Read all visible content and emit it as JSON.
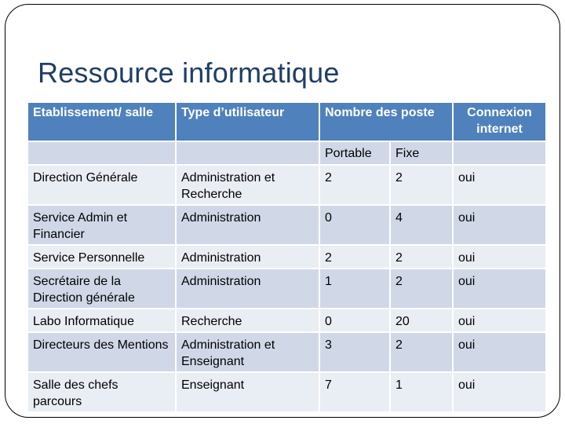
{
  "slide": {
    "title": "Ressource informatique"
  },
  "table": {
    "headers": {
      "establishment": "Etablissement/ salle",
      "user_type": "Type d’utilisateur",
      "post_count": "Nombre des poste",
      "internet_line1": "Connexion",
      "internet_line2": "internet"
    },
    "subheaders": {
      "portable": "Portable",
      "fixe": "Fixe"
    },
    "rows": [
      {
        "establishment": "Direction  Générale",
        "user_type": "Administration et Recherche",
        "portable": "2",
        "fixe": "2",
        "internet": "oui"
      },
      {
        "establishment": "Service Admin et Financier",
        "user_type": "Administration",
        "portable": "0",
        "fixe": "4",
        "internet": "oui"
      },
      {
        "establishment": "Service Personnelle",
        "user_type": "Administration",
        "portable": "2",
        "fixe": "2",
        "internet": "oui"
      },
      {
        "establishment": "Secrétaire de la Direction générale",
        "user_type": "Administration",
        "portable": "1",
        "fixe": "2",
        "internet": "oui"
      },
      {
        "establishment": "Labo Informatique",
        "user_type": "Recherche",
        "portable": "0",
        "fixe": "20",
        "internet": "oui"
      },
      {
        "establishment": "Directeurs des Mentions",
        "user_type": "Administration et Enseignant",
        "portable": "3",
        "fixe": "2",
        "internet": "oui"
      },
      {
        "establishment": "Salle des chefs parcours",
        "user_type": "Enseignant",
        "portable": "7",
        "fixe": "1",
        "internet": "oui"
      }
    ]
  },
  "colors": {
    "header": "#4f81bd",
    "row_light": "#e9edf4",
    "row_dark": "#d0d8e8",
    "title": "#1f3e67"
  }
}
